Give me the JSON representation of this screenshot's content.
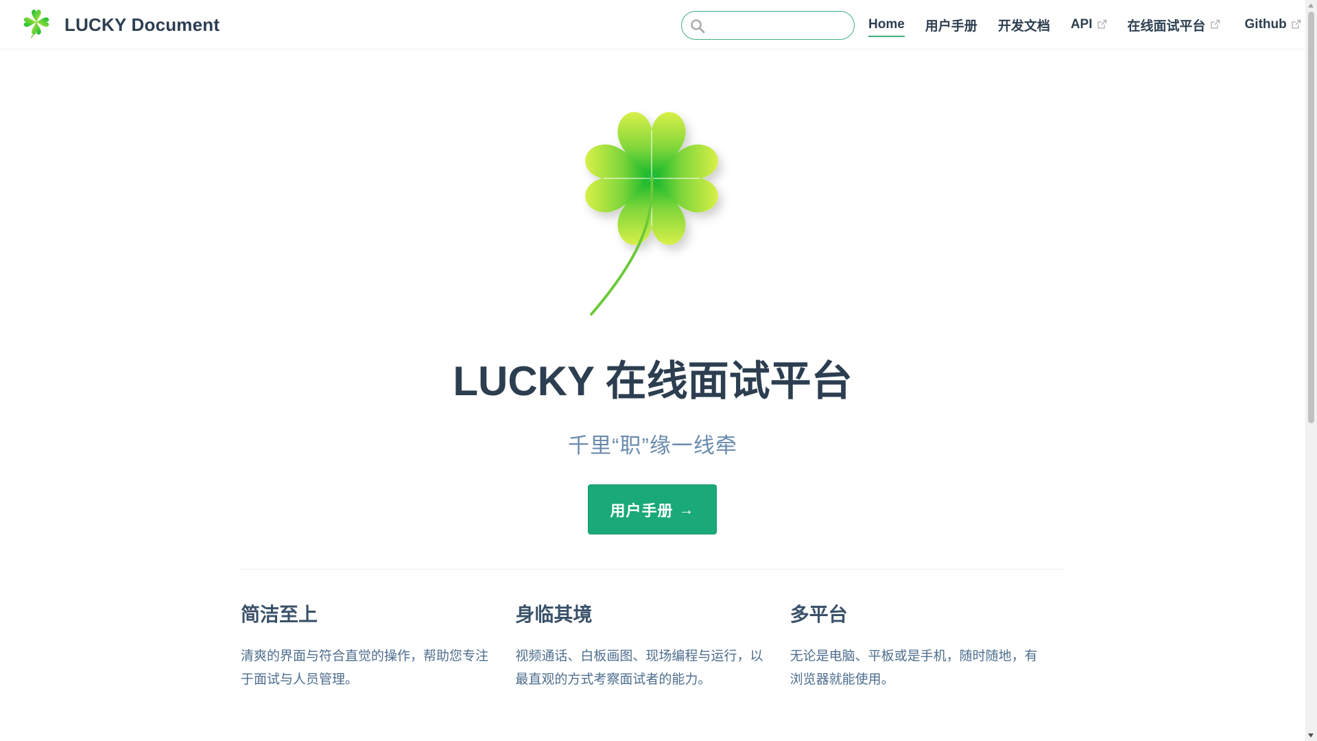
{
  "navbar": {
    "site_name": "LUCKY Document",
    "search": {
      "placeholder": "",
      "value": ""
    },
    "links": [
      {
        "label": "Home",
        "active": true,
        "external": false
      },
      {
        "label": "用户手册",
        "active": false,
        "external": false
      },
      {
        "label": "开发文档",
        "active": false,
        "external": false
      },
      {
        "label": "API",
        "active": false,
        "external": true
      },
      {
        "label": "在线面试平台",
        "active": false,
        "external": true
      },
      {
        "label": "Github",
        "active": false,
        "external": true
      }
    ]
  },
  "hero": {
    "image_icon": "four-leaf-clover-icon",
    "title": "LUCKY 在线面试平台",
    "description": "千里“职”缘一线牵",
    "action_label": "用户手册",
    "action_arrow": "→"
  },
  "features": [
    {
      "title": "简洁至上",
      "details": "清爽的界面与符合直觉的操作，帮助您专注于面试与人员管理。"
    },
    {
      "title": "身临其境",
      "details": "视频通话、白板画图、现场编程与运行，以最直观的方式考察面试者的能力。"
    },
    {
      "title": "多平台",
      "details": "无论是电脑、平板或是手机，随时随地，有浏览器就能使用。"
    }
  ],
  "colors": {
    "accent": "#3eaf7c",
    "action_button": "#1aa979",
    "text": "#2c3e50",
    "description": "#6a8bad"
  }
}
